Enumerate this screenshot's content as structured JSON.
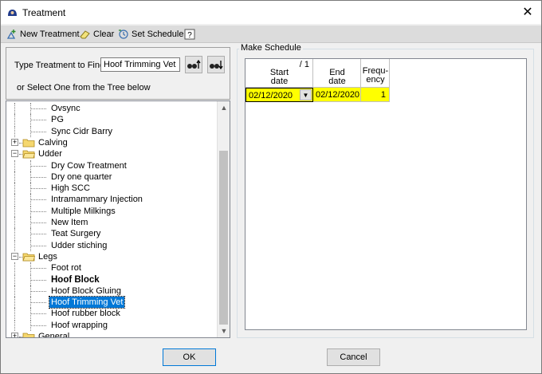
{
  "window": {
    "title": "Treatment"
  },
  "toolbar": {
    "new_treatment": "New Treatment",
    "clear": "Clear",
    "set_schedule": "Set Schedule"
  },
  "find": {
    "label": "Type Treatment to Find",
    "value": "Hoof Trimming Vet",
    "hint": "or Select One from the Tree below"
  },
  "tree": {
    "items": [
      {
        "text": "Ovsync",
        "level": 2
      },
      {
        "text": "PG",
        "level": 2
      },
      {
        "text": "Sync Cidr Barry",
        "level": 2
      },
      {
        "text": "Calving",
        "level": 1,
        "expander": "+"
      },
      {
        "text": "Udder",
        "level": 1,
        "expander": "-"
      },
      {
        "text": "Dry Cow Treatment",
        "level": 2
      },
      {
        "text": "Dry one quarter",
        "level": 2
      },
      {
        "text": "High SCC",
        "level": 2
      },
      {
        "text": "Intramammary Injection",
        "level": 2
      },
      {
        "text": "Multiple Milkings",
        "level": 2
      },
      {
        "text": "New Item",
        "level": 2
      },
      {
        "text": "Teat Surgery",
        "level": 2
      },
      {
        "text": "Udder stiching",
        "level": 2
      },
      {
        "text": "Legs",
        "level": 1,
        "expander": "-"
      },
      {
        "text": "Foot rot",
        "level": 2
      },
      {
        "text": "Hoof Block",
        "level": 2,
        "bold": true
      },
      {
        "text": "Hoof Block Gluing",
        "level": 2
      },
      {
        "text": "Hoof Trimming Vet",
        "level": 2,
        "selected": true
      },
      {
        "text": "Hoof rubber block",
        "level": 2
      },
      {
        "text": "Hoof wrapping",
        "level": 2
      },
      {
        "text": "General",
        "level": 1,
        "expander": "+"
      }
    ]
  },
  "schedule": {
    "group_label": "Make Schedule",
    "row_indicator": "/ 1",
    "headers": {
      "start": "Start\ndate",
      "end": "End\ndate",
      "freq": "Frequ-\nency"
    },
    "row": {
      "start": "02/12/2020",
      "end": "02/12/2020",
      "freq": "1"
    }
  },
  "buttons": {
    "ok": "OK",
    "cancel": "Cancel"
  }
}
